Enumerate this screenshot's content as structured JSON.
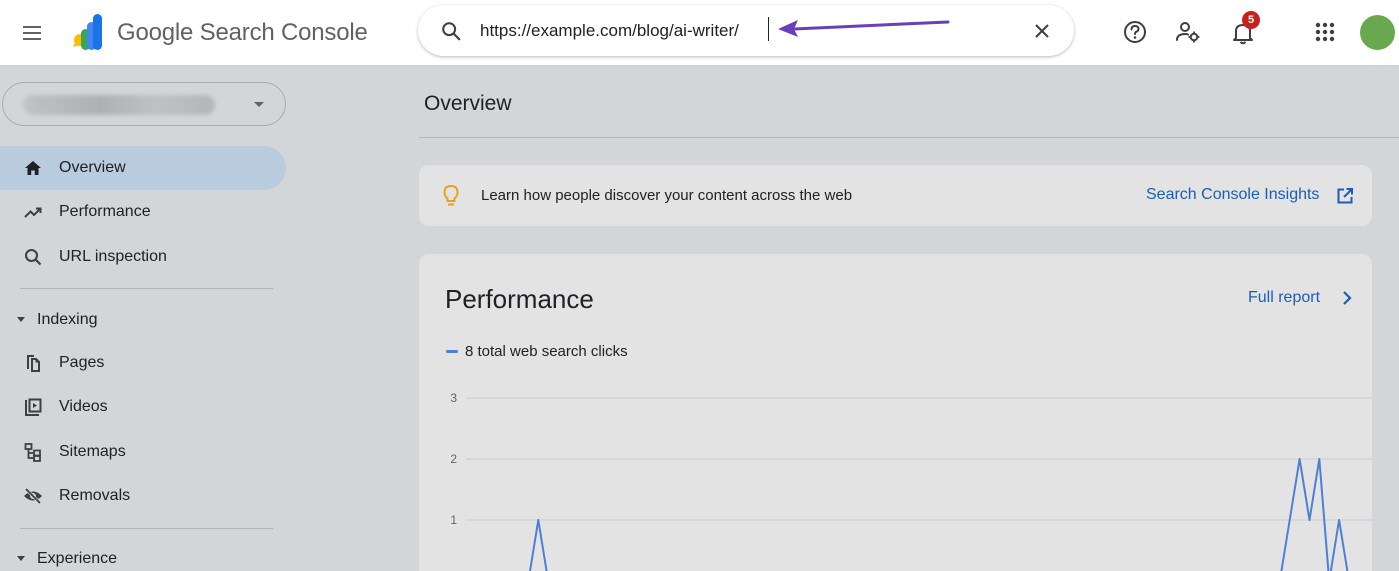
{
  "header": {
    "product_brand": "Google",
    "product_name": "Search Console",
    "search": {
      "value": "https://example.com/blog/ai-writer/",
      "placeholder": ""
    },
    "notifications_count": "5",
    "colors": {
      "accent": "#1a5fb4",
      "badge": "#c5221f",
      "annotation_arrow": "#6b3fb8",
      "avatar": "#6aa84f"
    },
    "icons": [
      "menu-icon",
      "search-console-logo",
      "search-icon",
      "close-icon",
      "help-icon",
      "user-settings-icon",
      "bell-icon",
      "apps-grid-icon"
    ]
  },
  "sidebar": {
    "property_value": "",
    "items": [
      {
        "label": "Overview",
        "icon": "home-icon",
        "active": true
      },
      {
        "label": "Performance",
        "icon": "trending-icon",
        "active": false
      },
      {
        "label": "URL inspection",
        "icon": "search-icon",
        "active": false
      }
    ],
    "sections": [
      {
        "label": "Indexing",
        "items": [
          {
            "label": "Pages",
            "icon": "pages-icon"
          },
          {
            "label": "Videos",
            "icon": "videos-icon"
          },
          {
            "label": "Sitemaps",
            "icon": "sitemap-icon"
          },
          {
            "label": "Removals",
            "icon": "removals-icon"
          }
        ]
      },
      {
        "label": "Experience",
        "items": []
      }
    ]
  },
  "main": {
    "title": "Overview",
    "insight": {
      "text": "Learn how people discover your content across the web",
      "link_label": "Search Console Insights"
    },
    "performance": {
      "title": "Performance",
      "full_report_label": "Full report",
      "legend_label": "8 total web search clicks"
    }
  },
  "chart_data": {
    "type": "line",
    "series": [
      {
        "name": "8 total web search clicks",
        "color": "#4d7fd8",
        "values": [
          0,
          0,
          0,
          0,
          0,
          0,
          1,
          0,
          0,
          0,
          0,
          0,
          0,
          0,
          0,
          0,
          0,
          0,
          0,
          0,
          0,
          0,
          0,
          0,
          0,
          0,
          0,
          0,
          0,
          0,
          0,
          0,
          0,
          0,
          0,
          0,
          0,
          0,
          0,
          0,
          0,
          0,
          0,
          0,
          0,
          0,
          0,
          0,
          0,
          0,
          0,
          0,
          0,
          0,
          0,
          0,
          0,
          0,
          0,
          0,
          0,
          0,
          0,
          0,
          0,
          0,
          0,
          0,
          0,
          0,
          0,
          0,
          0,
          0,
          0,
          0,
          0,
          0,
          0,
          0,
          0,
          0,
          1,
          2,
          1,
          2,
          0,
          1,
          0
        ]
      }
    ],
    "y_ticks": [
      "3",
      "2",
      "1"
    ],
    "ylim": [
      0,
      3
    ],
    "grid": true
  }
}
